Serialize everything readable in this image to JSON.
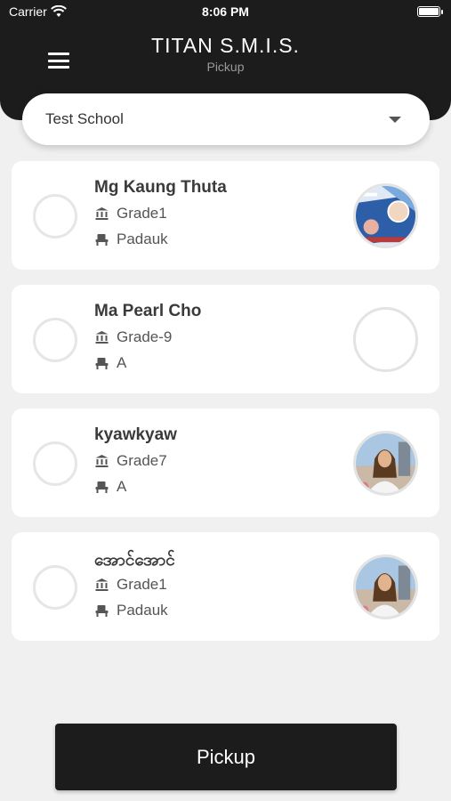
{
  "status_bar": {
    "carrier": "Carrier",
    "time": "8:06 PM"
  },
  "header": {
    "title": "TITAN S.M.I.S.",
    "subtitle": "Pickup"
  },
  "school_select": {
    "value": "Test School"
  },
  "students": [
    {
      "name": "Mg Kaung Thuta",
      "grade": "Grade1",
      "room": "Padauk",
      "avatar": "school-poster"
    },
    {
      "name": "Ma Pearl Cho",
      "grade": "Grade-9",
      "room": "A",
      "avatar": "empty"
    },
    {
      "name": "kyawkyaw",
      "grade": "Grade7",
      "room": "A",
      "avatar": "person-photo"
    },
    {
      "name": "အောင်အောင်",
      "grade": "Grade1",
      "room": "Padauk",
      "avatar": "person-photo"
    }
  ],
  "pickup_button": {
    "label": "Pickup"
  },
  "colors": {
    "header_bg": "#1c1c1c",
    "page_bg": "#f0f0f0",
    "card_bg": "#ffffff"
  }
}
